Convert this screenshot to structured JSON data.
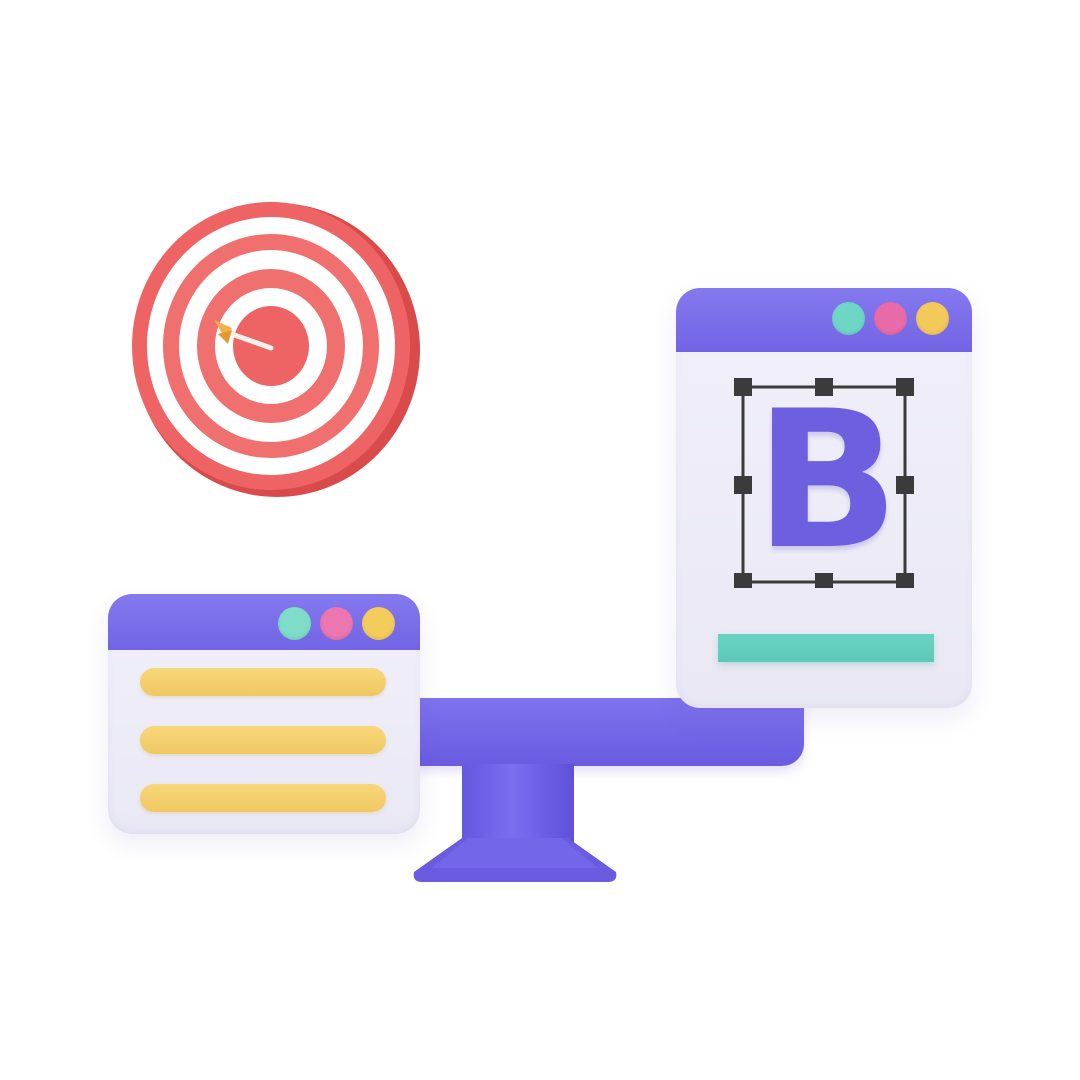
{
  "illustration": {
    "target": {
      "icon": "target-icon",
      "ring_color": "#ee6464",
      "gap_color": "#ffffff",
      "dart_color": "#f2b24a"
    },
    "left_window": {
      "header_color": "#7a6de8",
      "dots": [
        {
          "icon": "teal-dot-icon",
          "color": "#7fdcc8"
        },
        {
          "icon": "pink-dot-icon",
          "color": "#ec76b0"
        },
        {
          "icon": "yellow-dot-icon",
          "color": "#f4cc5c"
        }
      ],
      "line_count": 3,
      "line_color": "#f4cf6c"
    },
    "right_window": {
      "header_color": "#7264e4",
      "dots": [
        {
          "icon": "teal-dot-icon",
          "color": "#6dd6c4"
        },
        {
          "icon": "pink-dot-icon",
          "color": "#e86ba8"
        },
        {
          "icon": "yellow-dot-icon",
          "color": "#f3c95a"
        }
      ],
      "letter": "B",
      "letter_color": "#6d5fe0",
      "frame_color": "#3b3b3b",
      "bar_color": "#64cfbd"
    },
    "monitor": {
      "icon": "monitor-icon",
      "color": "#7264e4"
    }
  }
}
